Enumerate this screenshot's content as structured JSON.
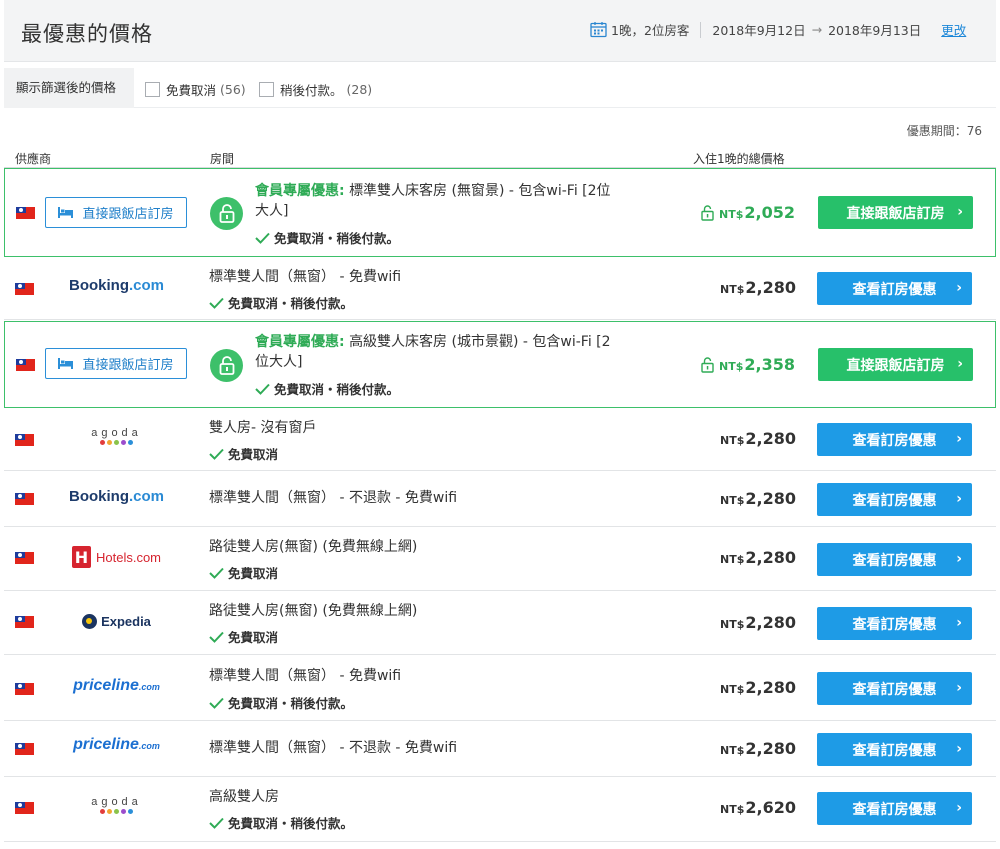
{
  "header": {
    "title": "最優惠的價格",
    "stay": "1晚，2位房客",
    "checkin": "2018年9月12日",
    "arrow": "→",
    "checkout": "2018年9月13日",
    "change_link": "更改"
  },
  "filters": {
    "label": "顯示篩選後的價格",
    "free_cancel": {
      "label": "免費取消",
      "count": "(56)"
    },
    "pay_later": {
      "label": "稍後付款。",
      "count": "(28)"
    }
  },
  "period_note": "優惠期間：76",
  "columns": {
    "provider": "供應商",
    "room": "房間",
    "price": "入住1晚的總價格"
  },
  "currency": "NT$",
  "colors": {
    "accent_blue": "#1e9be6",
    "accent_green": "#27c06a",
    "member_green": "#2fab56"
  },
  "offers": [
    {
      "provider": "直接跟飯店訂房",
      "provider_icon": "bed-icon",
      "member_label": "會員專屬優惠:",
      "room_line1": "標準雙人床客房 (無窗景) - 包含wi-Fi [2位",
      "room_line2": "大人]",
      "perks": "免費取消・稍後付款。",
      "price": "2,052",
      "button": "直接跟飯店訂房",
      "chevron": "›"
    },
    {
      "provider": "Booking.com",
      "room_line1": "標準雙人間（無窗） - 免費wifi",
      "perks": "免費取消・稍後付款。",
      "price": "2,280",
      "button": "查看訂房優惠",
      "chevron": "›"
    },
    {
      "provider": "直接跟飯店訂房",
      "provider_icon": "bed-icon",
      "member_label": "會員專屬優惠:",
      "room_line1": "高級雙人床客房 (城市景觀) - 包含wi-Fi [2",
      "room_line2": "位大人]",
      "perks": "免費取消・稍後付款。",
      "price": "2,358",
      "button": "直接跟飯店訂房",
      "chevron": "›"
    },
    {
      "provider": "agoda",
      "room_line1": "雙人房- 沒有窗戶",
      "perks": "免費取消",
      "price": "2,280",
      "button": "查看訂房優惠",
      "chevron": "›"
    },
    {
      "provider": "Booking.com",
      "room_line1": "標準雙人間（無窗） - 不退款 - 免費wifi",
      "price": "2,280",
      "button": "查看訂房優惠",
      "chevron": "›"
    },
    {
      "provider": "Hotels.com",
      "room_line1": "路徒雙人房(無窗) (免費無線上網)",
      "perks": "免費取消",
      "price": "2,280",
      "button": "查看訂房優惠",
      "chevron": "›"
    },
    {
      "provider": "Expedia",
      "room_line1": "路徒雙人房(無窗) (免費無線上網)",
      "perks": "免費取消",
      "price": "2,280",
      "button": "查看訂房優惠",
      "chevron": "›"
    },
    {
      "provider": "priceline.com",
      "room_line1": "標準雙人間（無窗） - 免費wifi",
      "perks": "免費取消・稍後付款。",
      "price": "2,280",
      "button": "查看訂房優惠",
      "chevron": "›"
    },
    {
      "provider": "priceline.com",
      "room_line1": "標準雙人間（無窗） - 不退款 - 免費wifi",
      "price": "2,280",
      "button": "查看訂房優惠",
      "chevron": "›"
    },
    {
      "provider": "agoda",
      "room_line1": "高級雙人房",
      "perks": "免費取消・稍後付款。",
      "price": "2,620",
      "button": "查看訂房優惠",
      "chevron": "›"
    }
  ]
}
